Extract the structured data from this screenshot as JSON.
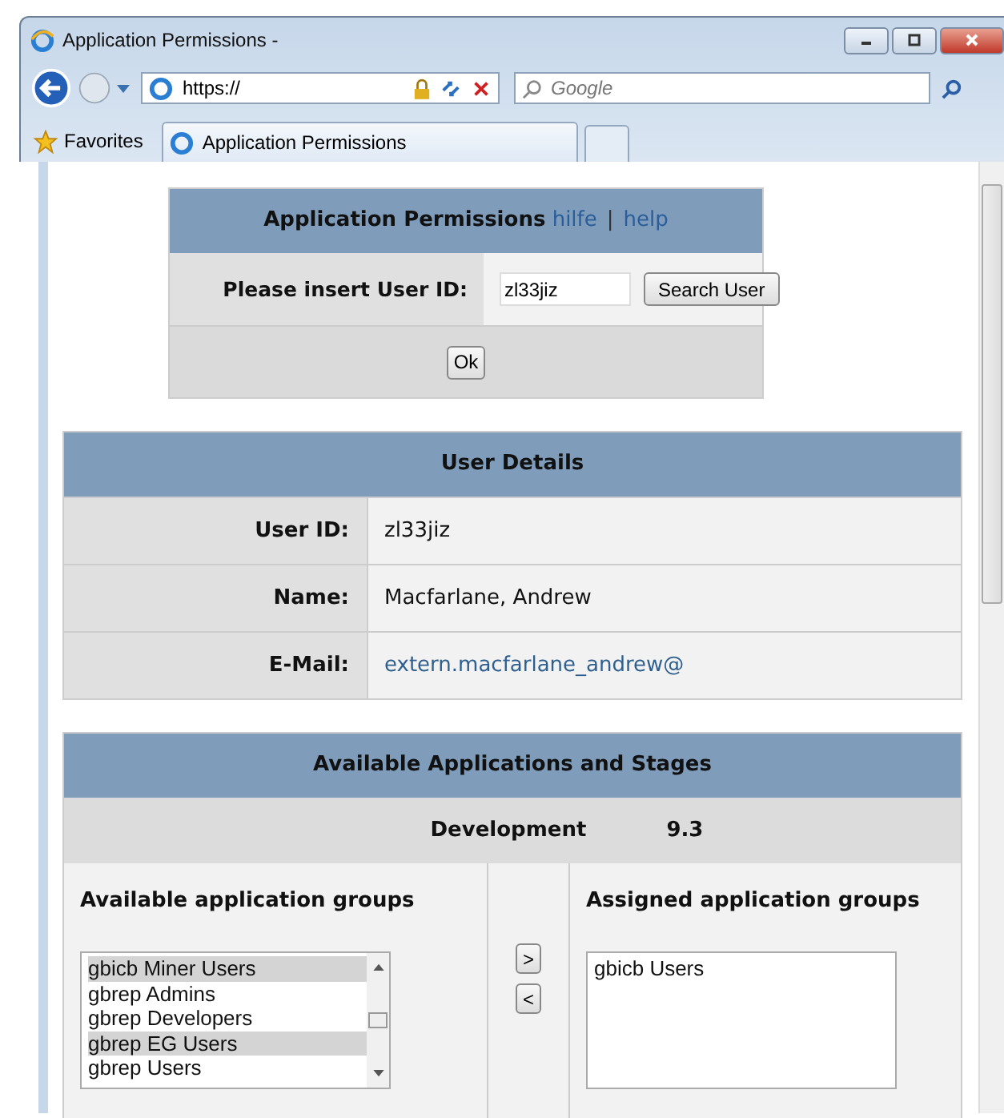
{
  "window": {
    "title": "Application Permissions -"
  },
  "toolbar": {
    "address": "https://",
    "search_placeholder": "Google"
  },
  "favorites": {
    "label": "Favorites"
  },
  "tabs": [
    {
      "label": "Application Permissions",
      "selected": true
    }
  ],
  "search_panel": {
    "title": "Application Permissions",
    "links": [
      "hilfe",
      "help"
    ],
    "separator": "|",
    "label": "Please insert User ID:",
    "user_id": "zl33jiz",
    "search_button": "Search User",
    "ok_button": "Ok"
  },
  "user_details": {
    "title": "User Details",
    "rows": [
      {
        "label": "User ID:",
        "value": "zl33jiz",
        "kind": "text"
      },
      {
        "label": "Name:",
        "value": "Macfarlane, Andrew",
        "kind": "text"
      },
      {
        "label": "E-Mail:",
        "value": "extern.macfarlane_andrew@",
        "kind": "link"
      }
    ]
  },
  "applications": {
    "title": "Available Applications and Stages",
    "stage": "Development",
    "version": "9.3",
    "available_title": "Available application groups",
    "assigned_title": "Assigned application groups",
    "add_button": ">",
    "remove_button": "<",
    "available": [
      {
        "label": "gbicb Miner Users",
        "selected": true
      },
      {
        "label": "gbrep Admins",
        "selected": false
      },
      {
        "label": "gbrep Developers",
        "selected": false
      },
      {
        "label": "gbrep EG Users",
        "selected": true
      },
      {
        "label": "gbrep Users",
        "selected": false
      }
    ],
    "assigned": [
      {
        "label": "gbicb Users",
        "selected": false
      }
    ]
  }
}
